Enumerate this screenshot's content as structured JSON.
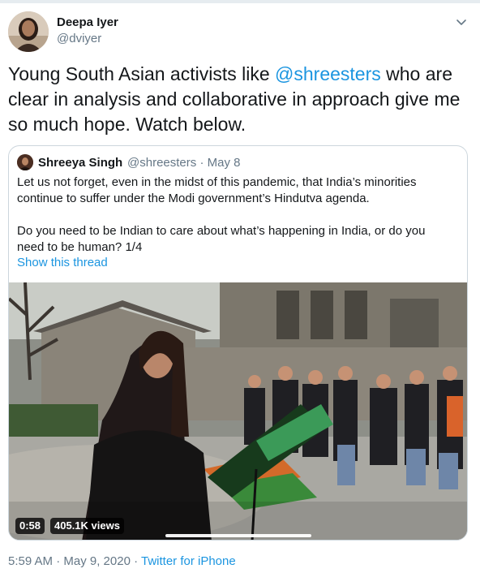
{
  "author": {
    "name": "Deepa Iyer",
    "handle": "@dviyer"
  },
  "tweet": {
    "text_before": "Young South Asian activists like ",
    "mention": "@shreesters",
    "text_after": " who are clear in analysis and collaborative in approach give me so much hope. Watch below."
  },
  "quoted": {
    "name": "Shreeya Singh",
    "handle": "@shreesters",
    "date": "· May 8",
    "paragraph1": "Let us not forget, even in the midst of this pandemic, that India’s minorities continue to suffer under the Modi government’s Hindutva agenda.",
    "paragraph2": "Do you need to be Indian to care about what’s happening in India, or do you need to be human? 1/4",
    "show_thread": "Show this thread",
    "video": {
      "duration": "0:58",
      "views": "405.1K views"
    }
  },
  "footer": {
    "time": "5:59 AM · May 9, 2020 · ",
    "source": "Twitter for iPhone"
  },
  "icons": {
    "chevron": "chevron-down-icon"
  },
  "colors": {
    "link": "#1b95e0",
    "secondary": "#657786",
    "border": "#ccd6dd"
  }
}
